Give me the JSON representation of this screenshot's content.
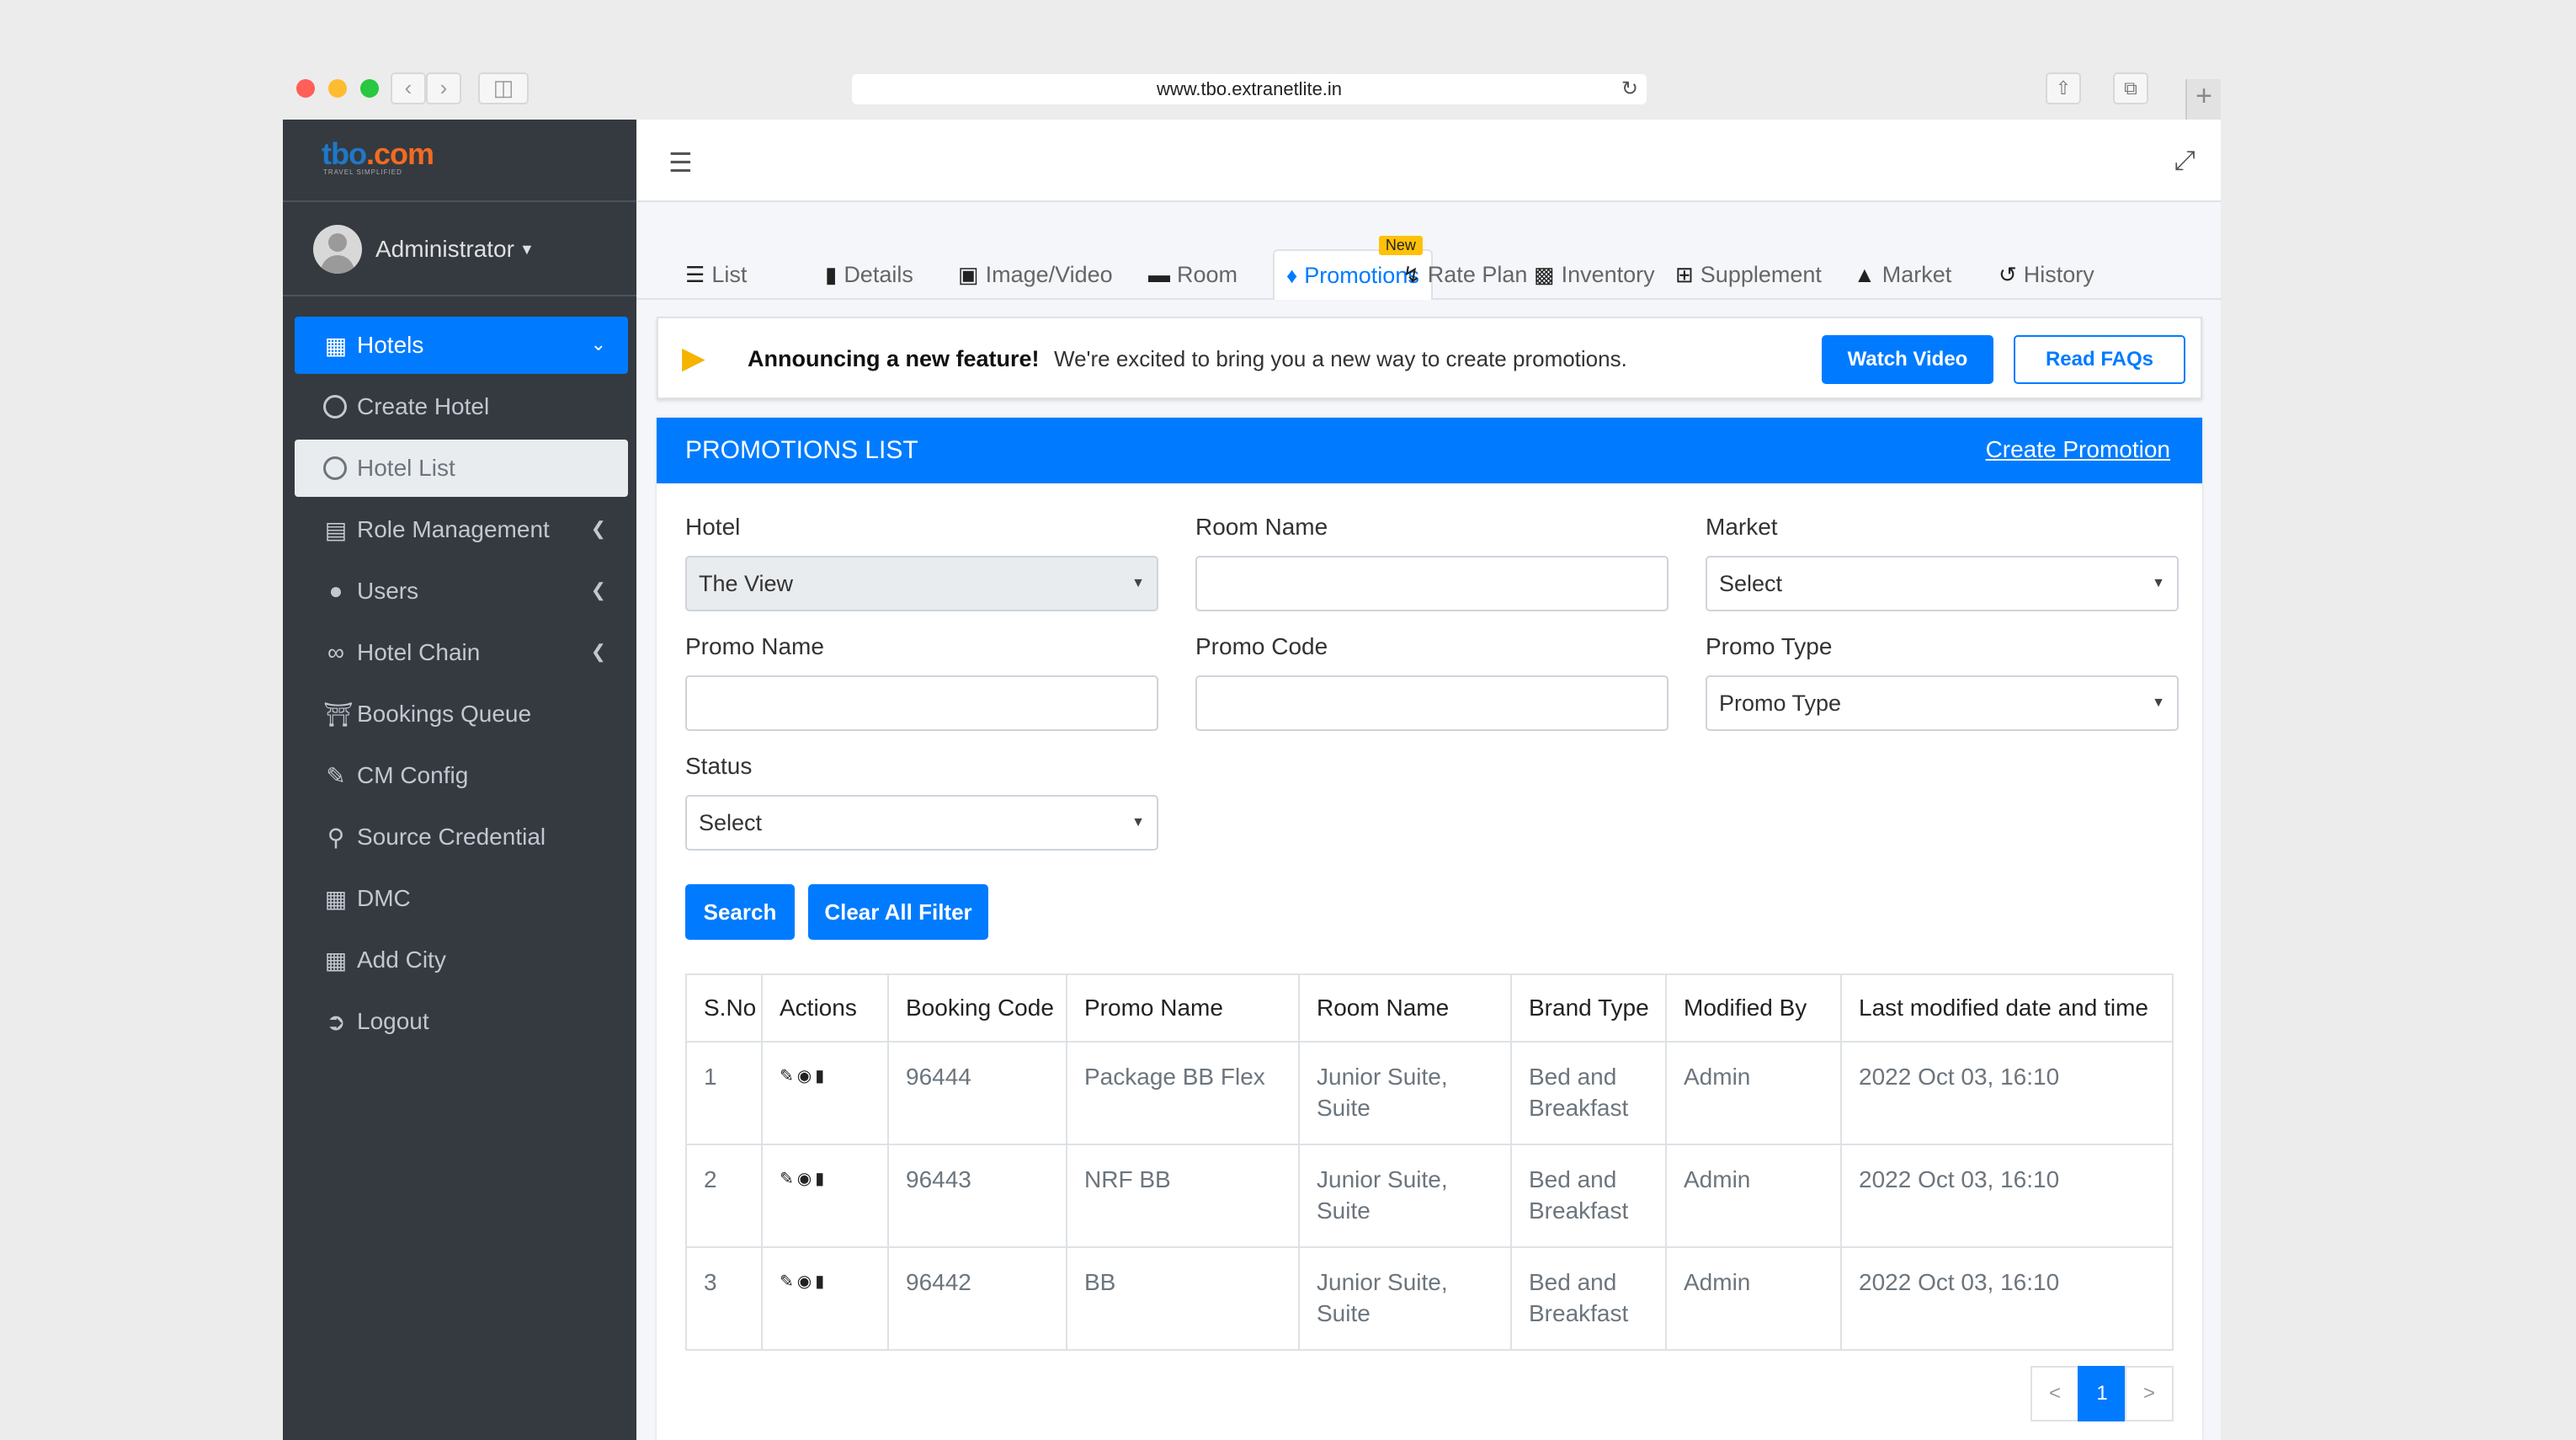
{
  "browser": {
    "url": "www.tbo.extranetlite.in"
  },
  "sidebar": {
    "logo_main": "tbo",
    "logo_accent": ".com",
    "logo_tagline": "TRAVEL SIMPLIFIED",
    "user": "Administrator",
    "items": [
      {
        "label": "Hotels",
        "icon": "building-icon"
      },
      {
        "label": "Create Hotel",
        "icon": "circle-icon"
      },
      {
        "label": "Hotel List",
        "icon": "circle-icon"
      },
      {
        "label": "Role Management",
        "icon": "clipboard-icon"
      },
      {
        "label": "Users",
        "icon": "user-icon"
      },
      {
        "label": "Hotel Chain",
        "icon": "link-icon"
      },
      {
        "label": "Bookings Queue",
        "icon": "cart-icon"
      },
      {
        "label": "CM Config",
        "icon": "brush-icon"
      },
      {
        "label": "Source Credential",
        "icon": "key-icon"
      },
      {
        "label": "DMC",
        "icon": "building-icon"
      },
      {
        "label": "Add City",
        "icon": "city-icon"
      },
      {
        "label": "Logout",
        "icon": "logout-icon"
      }
    ]
  },
  "tabs": [
    {
      "label": "List",
      "icon": "list-icon"
    },
    {
      "label": "Details",
      "icon": "file-icon"
    },
    {
      "label": "Image/Video",
      "icon": "image-icon"
    },
    {
      "label": "Room",
      "icon": "bed-icon"
    },
    {
      "label": "Promotions",
      "icon": "tags-icon",
      "badge": "New"
    },
    {
      "label": "Rate Plan",
      "icon": "bolt-icon"
    },
    {
      "label": "Inventory",
      "icon": "boxes-icon"
    },
    {
      "label": "Supplement",
      "icon": "plus-square-icon"
    },
    {
      "label": "Market",
      "icon": "chart-icon"
    },
    {
      "label": "History",
      "icon": "history-icon"
    }
  ],
  "announcement": {
    "title": "Announcing a new feature!",
    "text": "We're excited to bring you a new way to create promotions.",
    "watch": "Watch Video",
    "faq": "Read FAQs"
  },
  "card": {
    "title": "PROMOTIONS LIST",
    "create_link": "Create Promotion"
  },
  "filters": {
    "hotel_label": "Hotel",
    "hotel_value": "The View",
    "room_label": "Room Name",
    "room_value": "",
    "market_label": "Market",
    "market_value": "Select",
    "promo_name_label": "Promo Name",
    "promo_name_value": "",
    "promo_code_label": "Promo Code",
    "promo_code_value": "",
    "promo_type_label": "Promo Type",
    "promo_type_value": "Promo Type",
    "status_label": "Status",
    "status_value": "Select",
    "search": "Search",
    "clear": "Clear All Filter"
  },
  "table": {
    "headers": [
      "S.No",
      "Actions",
      "Booking Code",
      "Promo Name",
      "Room Name",
      "Brand Type",
      "Modified By",
      "Last modified date and time"
    ],
    "rows": [
      {
        "sno": "1",
        "code": "96444",
        "promo": "Package BB Flex",
        "room": "Junior Suite, Suite",
        "brand": "Bed and Breakfast",
        "by": "Admin",
        "date": "2022 Oct 03, 16:10"
      },
      {
        "sno": "2",
        "code": "96443",
        "promo": "NRF BB",
        "room": "Junior Suite, Suite",
        "brand": "Bed and Breakfast",
        "by": "Admin",
        "date": "2022 Oct 03, 16:10"
      },
      {
        "sno": "3",
        "code": "96442",
        "promo": "BB",
        "room": "Junior Suite, Suite",
        "brand": "Bed and Breakfast",
        "by": "Admin",
        "date": "2022 Oct 03, 16:10"
      }
    ]
  },
  "pager": {
    "prev": "<",
    "page": "1",
    "next": ">"
  }
}
